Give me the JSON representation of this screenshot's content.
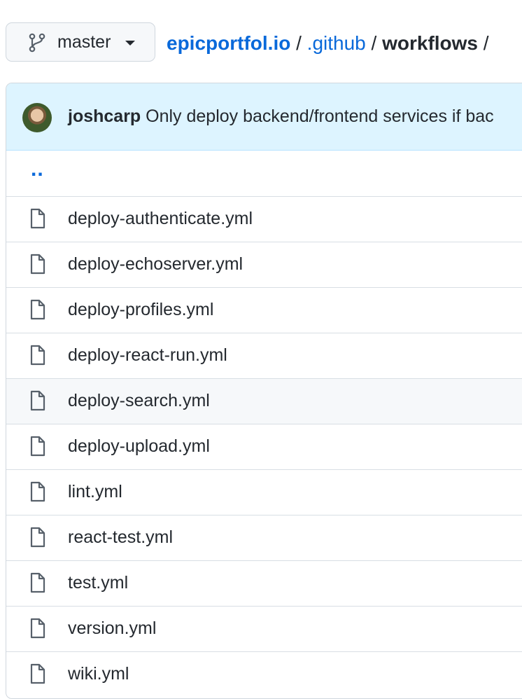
{
  "branch": {
    "label": "master"
  },
  "breadcrumb": {
    "repo": "epicportfol.io",
    "sep1": " / ",
    "dir1": ".github",
    "sep2": " / ",
    "current": "workflows",
    "sep3": " /"
  },
  "commit": {
    "author": "joshcarp",
    "message": " Only deploy backend/frontend services if bac"
  },
  "parent": {
    "label": ".."
  },
  "files": [
    "deploy-authenticate.yml",
    "deploy-echoserver.yml",
    "deploy-profiles.yml",
    "deploy-react-run.yml",
    "deploy-search.yml",
    "deploy-upload.yml",
    "lint.yml",
    "react-test.yml",
    "test.yml",
    "version.yml",
    "wiki.yml"
  ],
  "icons": {
    "branch": "git-branch-icon",
    "file": "file-icon",
    "caret": "caret-down-icon"
  },
  "colors": {
    "link": "#0969da",
    "commit_bar": "#ddf4ff",
    "hover_row": "#f6f8fa"
  }
}
